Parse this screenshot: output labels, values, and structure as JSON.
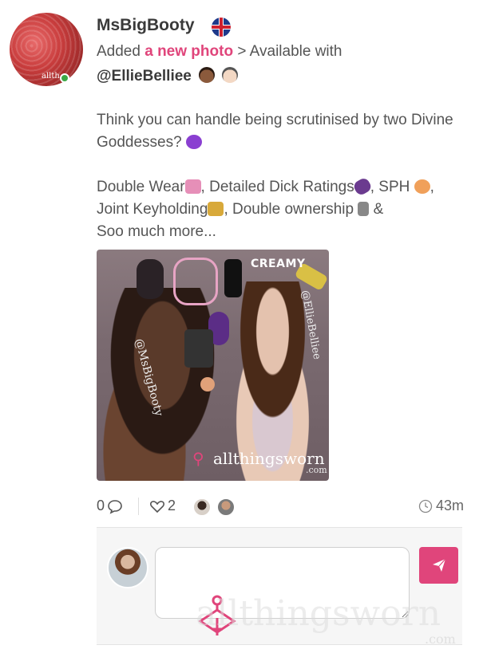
{
  "post": {
    "username": "MsBigBooty",
    "flag_icon": "uk-flag-icon",
    "activity_prefix": "Added",
    "activity_link": "a new photo",
    "activity_suffix": "> Available with",
    "mention": "@EllieBelliee",
    "body": {
      "line1": "Think you can handle being scrutinised by two Divine Goddesses?",
      "line2_a": "Double Wear",
      "line2_b": ", Detailed Dick Ratings",
      "line2_c": ", SPH",
      "line2_d": ", Joint Keyholding",
      "line2_e": ", Double ownership",
      "line2_f": " &",
      "line2_g": "Soo much more..."
    },
    "photo": {
      "sticker_text": "CREAMY",
      "tag_left": "@MsBigBooty",
      "tag_right": "@EllieBelliee",
      "watermark": "allthingsworn",
      "watermark_com": ".com"
    }
  },
  "stats": {
    "comments": "0",
    "likes": "2",
    "time": "43m"
  },
  "comment_box": {
    "placeholder": "",
    "send_icon": "paper-plane-icon"
  },
  "watermark": {
    "text": "allthingsworn",
    "com": ".com"
  },
  "colors": {
    "accent": "#e0457b",
    "online": "#3aa845"
  },
  "avatar_text": "allth"
}
